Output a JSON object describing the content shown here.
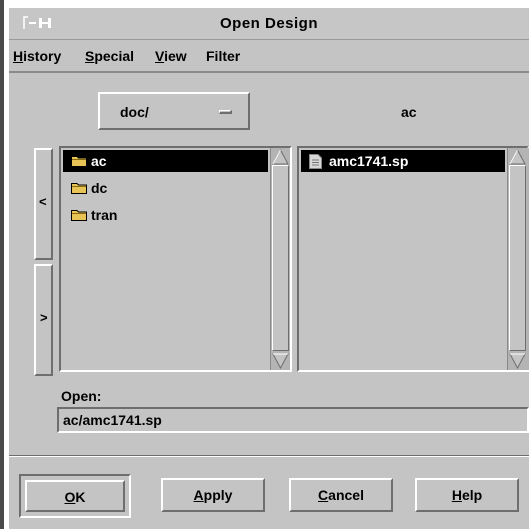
{
  "window": {
    "title": "Open Design"
  },
  "menubar": {
    "items": [
      "History",
      "Special",
      "View",
      "Filter"
    ],
    "mnemonics": [
      "H",
      "S",
      "V",
      "F"
    ]
  },
  "directory": {
    "selected": "doc/"
  },
  "current_folder": "ac",
  "left_list": {
    "items": [
      {
        "label": "ac",
        "icon": "folder-icon",
        "selected": true
      },
      {
        "label": "dc",
        "icon": "folder-icon",
        "selected": false
      },
      {
        "label": "tran",
        "icon": "folder-icon",
        "selected": false
      }
    ]
  },
  "right_list": {
    "items": [
      {
        "label": "amc1741.sp",
        "icon": "document-icon",
        "selected": true
      }
    ]
  },
  "nav": {
    "back": "<",
    "forward": ">"
  },
  "open": {
    "label": "Open:",
    "value": "ac/amc1741.sp"
  },
  "buttons": {
    "ok": {
      "pre": "",
      "mn": "O",
      "post": "K"
    },
    "apply": {
      "pre": "",
      "mn": "A",
      "post": "pply"
    },
    "cancel": {
      "pre": "",
      "mn": "C",
      "post": "ancel"
    },
    "help": {
      "pre": "",
      "mn": "H",
      "post": "elp"
    }
  },
  "colors": {
    "background": "#c4c4c4",
    "selection": "#000000",
    "folder": "#e8c456"
  }
}
